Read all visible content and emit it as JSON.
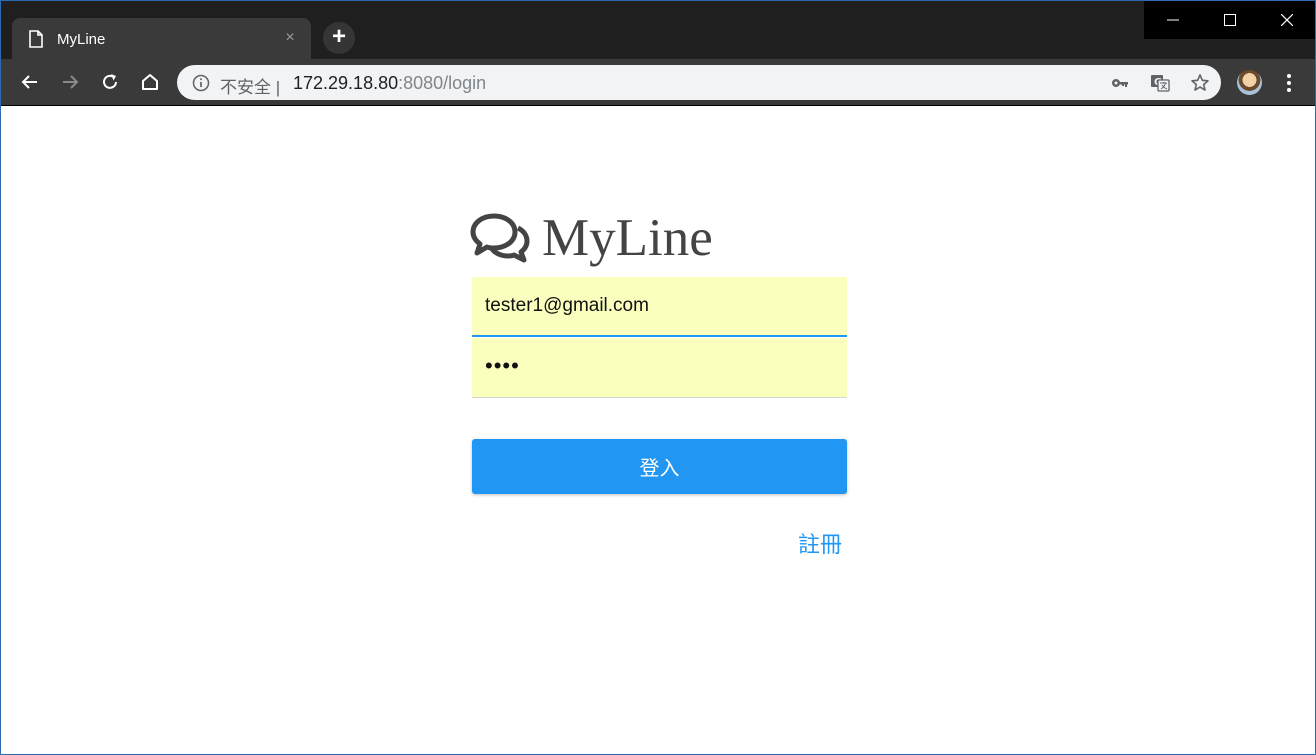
{
  "browser": {
    "tab_title": "MyLine",
    "tab_close": "×",
    "new_tab": "+",
    "security_label": "不安全 |",
    "url_host": "172.29.18.80",
    "url_rest": ":8080/login"
  },
  "icons": {
    "tab": "document-icon",
    "back": "arrow-left-icon",
    "forward": "arrow-right-icon",
    "reload": "reload-icon",
    "home": "home-icon",
    "info": "info-icon",
    "key": "key-icon",
    "translate": "translate-icon",
    "bookmark": "star-icon",
    "menu": "more-vertical-icon",
    "logo": "chat-bubbles-icon"
  },
  "page": {
    "logo_text": "MyLine",
    "email_value": "tester1@gmail.com",
    "password_mask": "••••",
    "login_label": "登入",
    "register_label": "註冊"
  },
  "colors": {
    "accent": "#2196f3",
    "autofill_bg": "#faffbd",
    "logo_text": "#444444"
  }
}
